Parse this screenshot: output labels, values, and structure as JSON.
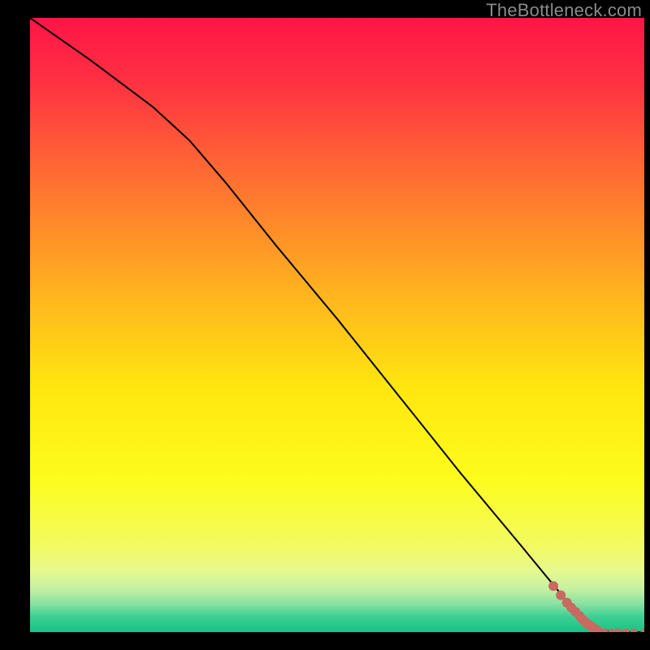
{
  "attribution": "TheBottleneck.com",
  "chart_data": {
    "type": "line",
    "title": "",
    "xlabel": "",
    "ylabel": "",
    "xlim": [
      0,
      1
    ],
    "ylim": [
      0,
      1
    ],
    "background_gradient": {
      "stops": [
        {
          "offset": 0.0,
          "color": "#ff1547"
        },
        {
          "offset": 0.1,
          "color": "#ff2f42"
        },
        {
          "offset": 0.25,
          "color": "#ff6a33"
        },
        {
          "offset": 0.45,
          "color": "#ffb41e"
        },
        {
          "offset": 0.6,
          "color": "#ffe60f"
        },
        {
          "offset": 0.75,
          "color": "#fdfc1c"
        },
        {
          "offset": 0.86,
          "color": "#f2fb62"
        },
        {
          "offset": 0.9,
          "color": "#e6f98f"
        },
        {
          "offset": 0.93,
          "color": "#c4f0a2"
        },
        {
          "offset": 0.955,
          "color": "#86e0a1"
        },
        {
          "offset": 0.975,
          "color": "#3ccf93"
        },
        {
          "offset": 1.0,
          "color": "#17c387"
        }
      ]
    },
    "series": [
      {
        "name": "bottleneck-curve",
        "color": "#000000",
        "x": [
          0.0,
          0.1,
          0.2,
          0.26,
          0.32,
          0.4,
          0.5,
          0.6,
          0.7,
          0.8,
          0.87,
          0.905,
          0.92,
          0.95,
          1.0
        ],
        "y": [
          1.0,
          0.93,
          0.855,
          0.8,
          0.73,
          0.63,
          0.51,
          0.385,
          0.26,
          0.14,
          0.055,
          0.015,
          0.005,
          0.0,
          0.0
        ]
      }
    ],
    "points": {
      "name": "selected-points",
      "color": "#c96a60",
      "radius_medium": 6,
      "radius_small": 4.5,
      "x": [
        0.852,
        0.864,
        0.874,
        0.881,
        0.888,
        0.895,
        0.9,
        0.905,
        0.91,
        0.914,
        0.918,
        0.925,
        0.935,
        0.947,
        0.958,
        0.97,
        0.983,
        1.0
      ],
      "y": [
        0.075,
        0.06,
        0.048,
        0.04,
        0.033,
        0.026,
        0.02,
        0.015,
        0.012,
        0.009,
        0.006,
        0.002,
        0.0,
        0.0,
        0.0,
        0.0,
        0.0,
        0.0
      ],
      "sizes": [
        "m",
        "m",
        "m",
        "m",
        "m",
        "m",
        "m",
        "m",
        "m",
        "m",
        "m",
        "m",
        "s",
        "s",
        "s",
        "s",
        "s",
        "s"
      ]
    }
  }
}
